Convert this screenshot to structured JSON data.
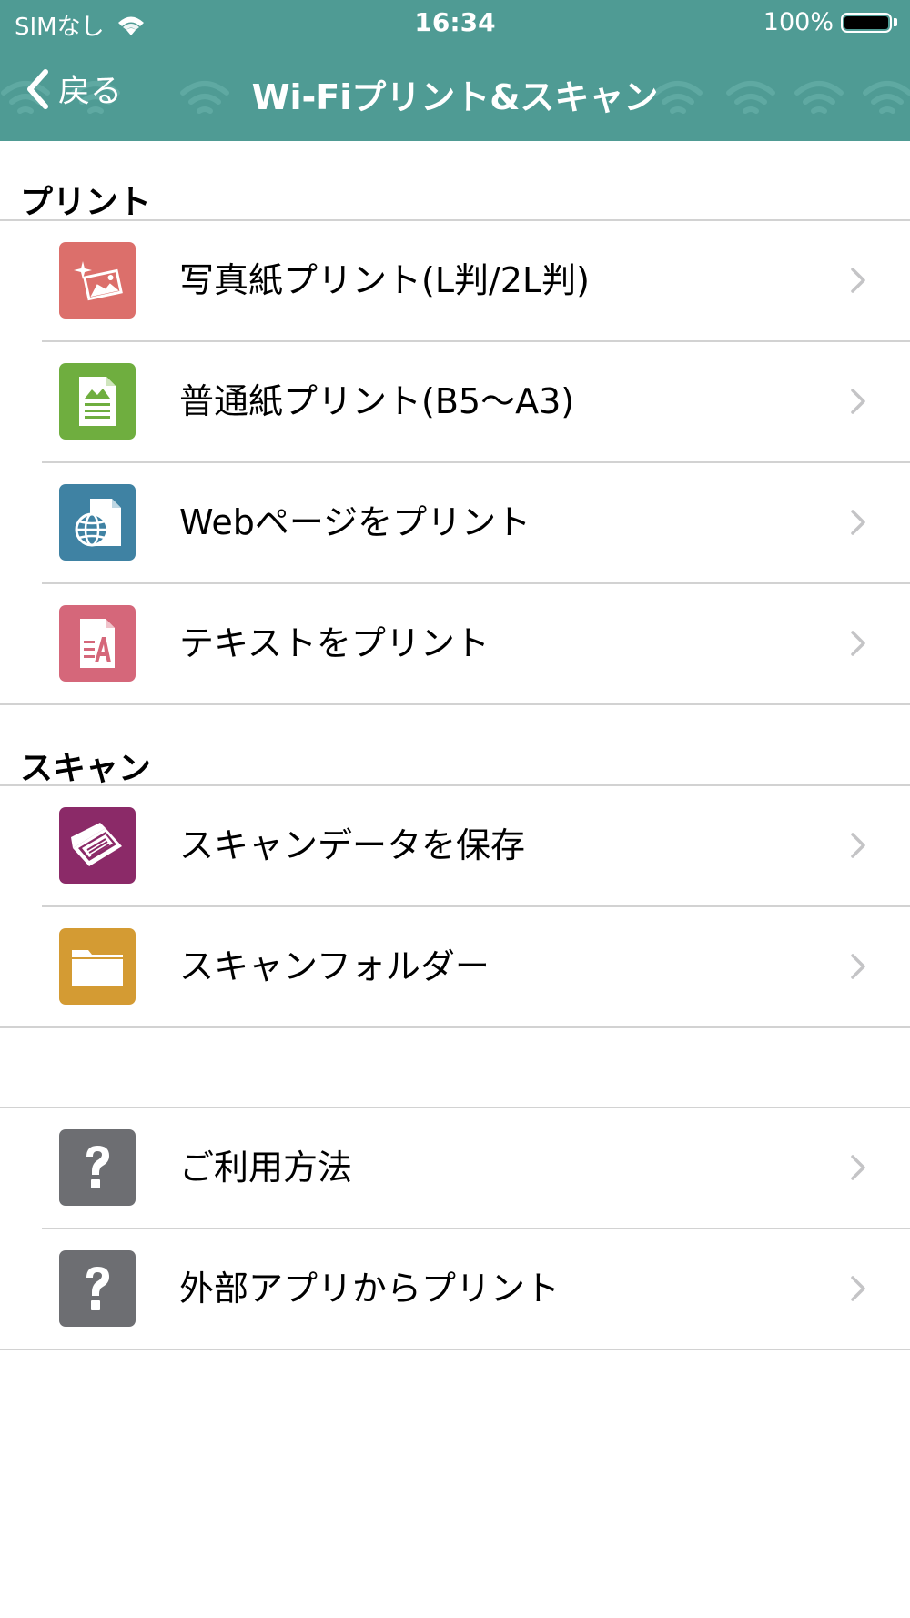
{
  "status": {
    "carrier": "SIMなし",
    "time": "16:34",
    "battery": "100%"
  },
  "nav": {
    "back_label": "戻る",
    "title": "Wi-Fiプリント&スキャン"
  },
  "sections": {
    "print": {
      "header": "プリント",
      "items": [
        {
          "label": "写真紙プリント(L判/2L判)",
          "icon": "photo-print-icon",
          "color": "#dc6f6b"
        },
        {
          "label": "普通紙プリント(B5〜A3)",
          "icon": "document-print-icon",
          "color": "#6fae3f"
        },
        {
          "label": "Webページをプリント",
          "icon": "web-print-icon",
          "color": "#3f82a3"
        },
        {
          "label": "テキストをプリント",
          "icon": "text-print-icon",
          "color": "#d5677a"
        }
      ]
    },
    "scan": {
      "header": "スキャン",
      "items": [
        {
          "label": "スキャンデータを保存",
          "icon": "scanner-icon",
          "color": "#8b2a68"
        },
        {
          "label": "スキャンフォルダー",
          "icon": "folder-icon",
          "color": "#d49b33"
        }
      ]
    },
    "help": {
      "items": [
        {
          "label": "ご利用方法",
          "icon": "help-icon",
          "color": "#6d6e72"
        },
        {
          "label": "外部アプリからプリント",
          "icon": "help-icon",
          "color": "#6d6e72"
        }
      ]
    }
  },
  "colors": {
    "header_bg": "#4f9b94",
    "divider": "#d2d2d2",
    "chevron": "#c4c4c6"
  }
}
